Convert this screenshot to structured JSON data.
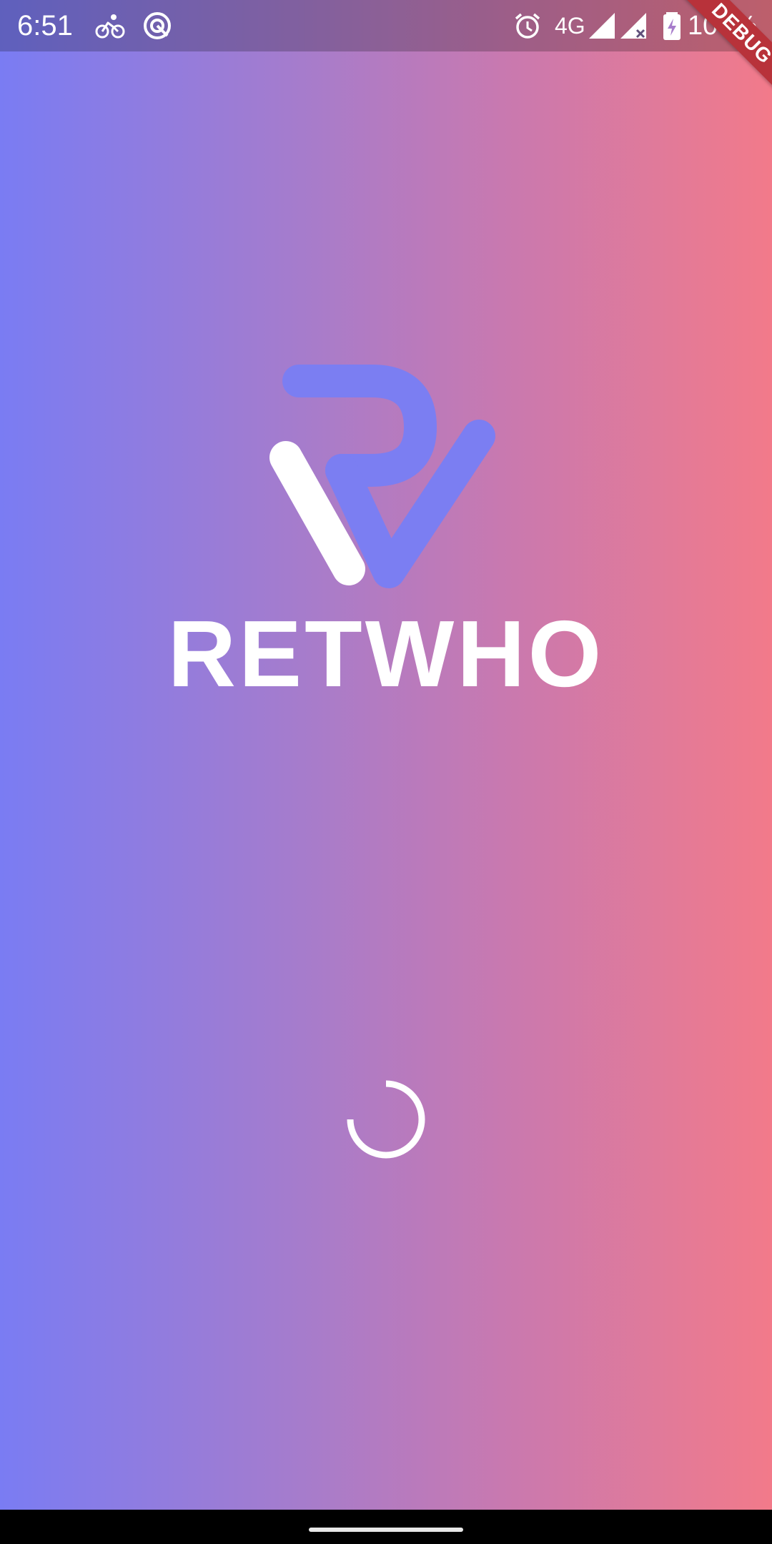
{
  "status_bar": {
    "time": "6:51",
    "network": "4G",
    "battery": "100%",
    "icons": [
      "cycling-icon",
      "data-saver-icon",
      "alarm-icon",
      "signal-icon",
      "signal-no-sim-icon",
      "battery-charging-icon"
    ]
  },
  "debug_banner": "DEBUG",
  "app": {
    "name": "RETWHO"
  },
  "colors": {
    "gradient_start": "#7a7cf3",
    "gradient_end": "#f27a8a",
    "logo_accent": "#7b7ef2",
    "logo_white": "#ffffff",
    "debug_red": "#b8323a"
  }
}
